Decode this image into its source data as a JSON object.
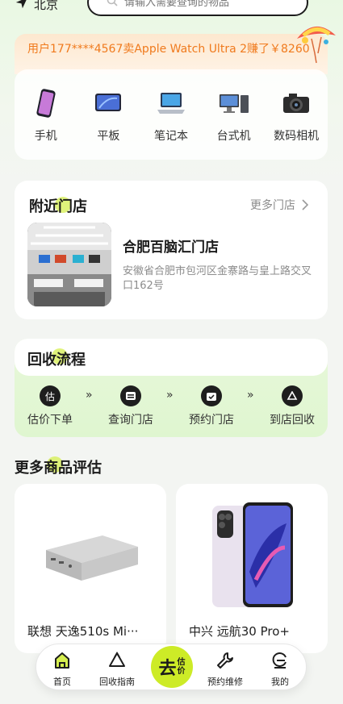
{
  "header": {
    "location": "北京",
    "search_placeholder": "请输入需要查询的物品"
  },
  "banner": {
    "text": "用户177****4567卖Apple Watch Ultra 2赚了￥8260"
  },
  "categories": [
    {
      "label": "手机",
      "icon": "phone-icon"
    },
    {
      "label": "平板",
      "icon": "tablet-icon"
    },
    {
      "label": "笔记本",
      "icon": "laptop-icon"
    },
    {
      "label": "台式机",
      "icon": "desktop-icon"
    },
    {
      "label": "数码相机",
      "icon": "camera-icon"
    }
  ],
  "nearby": {
    "title": "附近门店",
    "more": "更多门店",
    "store_name": "合肥百脑汇门店",
    "store_address": "安徽省合肥市包河区金寨路与皇上路交叉口162号"
  },
  "process": {
    "title": "回收流程",
    "steps": [
      {
        "label": "估价下单",
        "icon": "estimate-icon",
        "glyph": "估"
      },
      {
        "label": "查询门店",
        "icon": "store-icon",
        "glyph": ""
      },
      {
        "label": "预约门店",
        "icon": "calendar-check-icon",
        "glyph": ""
      },
      {
        "label": "到店回收",
        "icon": "recycle-icon",
        "glyph": ""
      }
    ],
    "arrow": "»"
  },
  "more_goods": {
    "title": "更多商品评估",
    "items": [
      {
        "name": "联想 天逸510s Mi···",
        "image": "mini-pc-image"
      },
      {
        "name": "中兴 远航30 Pro+",
        "image": "smartphone-image"
      }
    ]
  },
  "tabbar": {
    "tabs": [
      {
        "label": "首页",
        "icon": "home-icon"
      },
      {
        "label": "回收指南",
        "icon": "recycle-guide-icon"
      },
      {
        "label": "预约维修",
        "icon": "wrench-icon"
      },
      {
        "label": "我的",
        "icon": "profile-icon"
      }
    ],
    "center_main": "去",
    "center_sub_1": "估",
    "center_sub_2": "价"
  },
  "colors": {
    "accent": "#cdeb27",
    "banner_text": "#f07a1d",
    "background": "#f3f5f2"
  }
}
